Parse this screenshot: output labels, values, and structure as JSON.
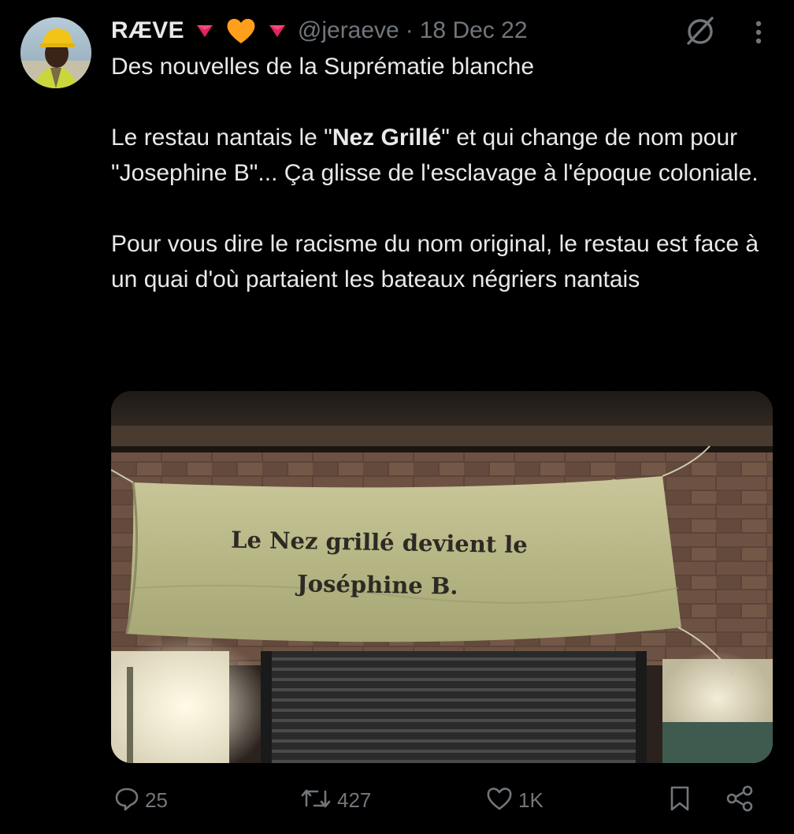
{
  "tweet": {
    "display_name": "RÆVE",
    "handle": "@jeraeve",
    "separator": "·",
    "date": "18 Dec 22",
    "text": {
      "line1": "Des nouvelles de la Suprématie blanche",
      "p2_before": "Le restau nantais le \"",
      "p2_bold": "Nez Grillé",
      "p2_after": "\" et qui change de nom pour \"Josephine B\"... Ça glisse de l'esclavage à l'époque coloniale.",
      "p3": "Pour vous dire le racisme du nom original, le restau est face à un quai d'où partaient les bateaux négriers nantais"
    },
    "media": {
      "banner_line1": "Le Nez grillé devient le",
      "banner_line2": "Joséphine B."
    },
    "actions": {
      "replies": "25",
      "retweets": "427",
      "likes": "1K"
    }
  },
  "colors": {
    "background": "#000000",
    "text_primary": "#e7e9ea",
    "text_secondary": "#71767b",
    "red_triangle": "#e0245e",
    "orange_heart": "#ff9f1c"
  },
  "icons": {
    "avatar": "avatar",
    "badge1": "red-triangle-down-icon",
    "badge2": "orange-heart-icon",
    "badge3": "red-triangle-down-icon",
    "grok": "grok-icon",
    "more": "more-vertical-icon",
    "reply": "reply-icon",
    "retweet": "retweet-icon",
    "like": "like-icon",
    "bookmark": "bookmark-icon",
    "share": "share-icon"
  }
}
